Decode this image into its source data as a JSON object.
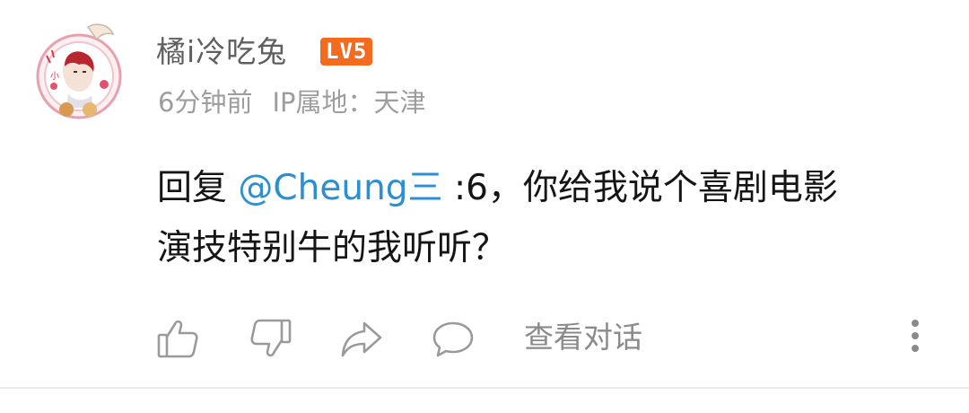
{
  "comment": {
    "username": "橘i冷吃兔",
    "level_badge": "LV5",
    "time": "6分钟前",
    "ip_location": "IP属地：天津",
    "reply_prefix": "回复 ",
    "mention": "@Cheung三",
    "text_line1": " :6，你给我说个喜剧电影",
    "text_line2": "演技特别牛的我听听？"
  },
  "actions": {
    "like_icon": "thumbs-up-icon",
    "dislike_icon": "thumbs-down-icon",
    "share_icon": "share-arrow-icon",
    "reply_icon": "speech-bubble-icon",
    "view_conversation": "查看对话",
    "more_icon": "vertical-ellipsis-icon"
  },
  "colors": {
    "level_badge": "#f26b1f",
    "mention": "#2b8fd1",
    "username": "#5f5f5f",
    "meta": "#9d9d9d",
    "body": "#151515",
    "icon": "#9a9a9a"
  }
}
